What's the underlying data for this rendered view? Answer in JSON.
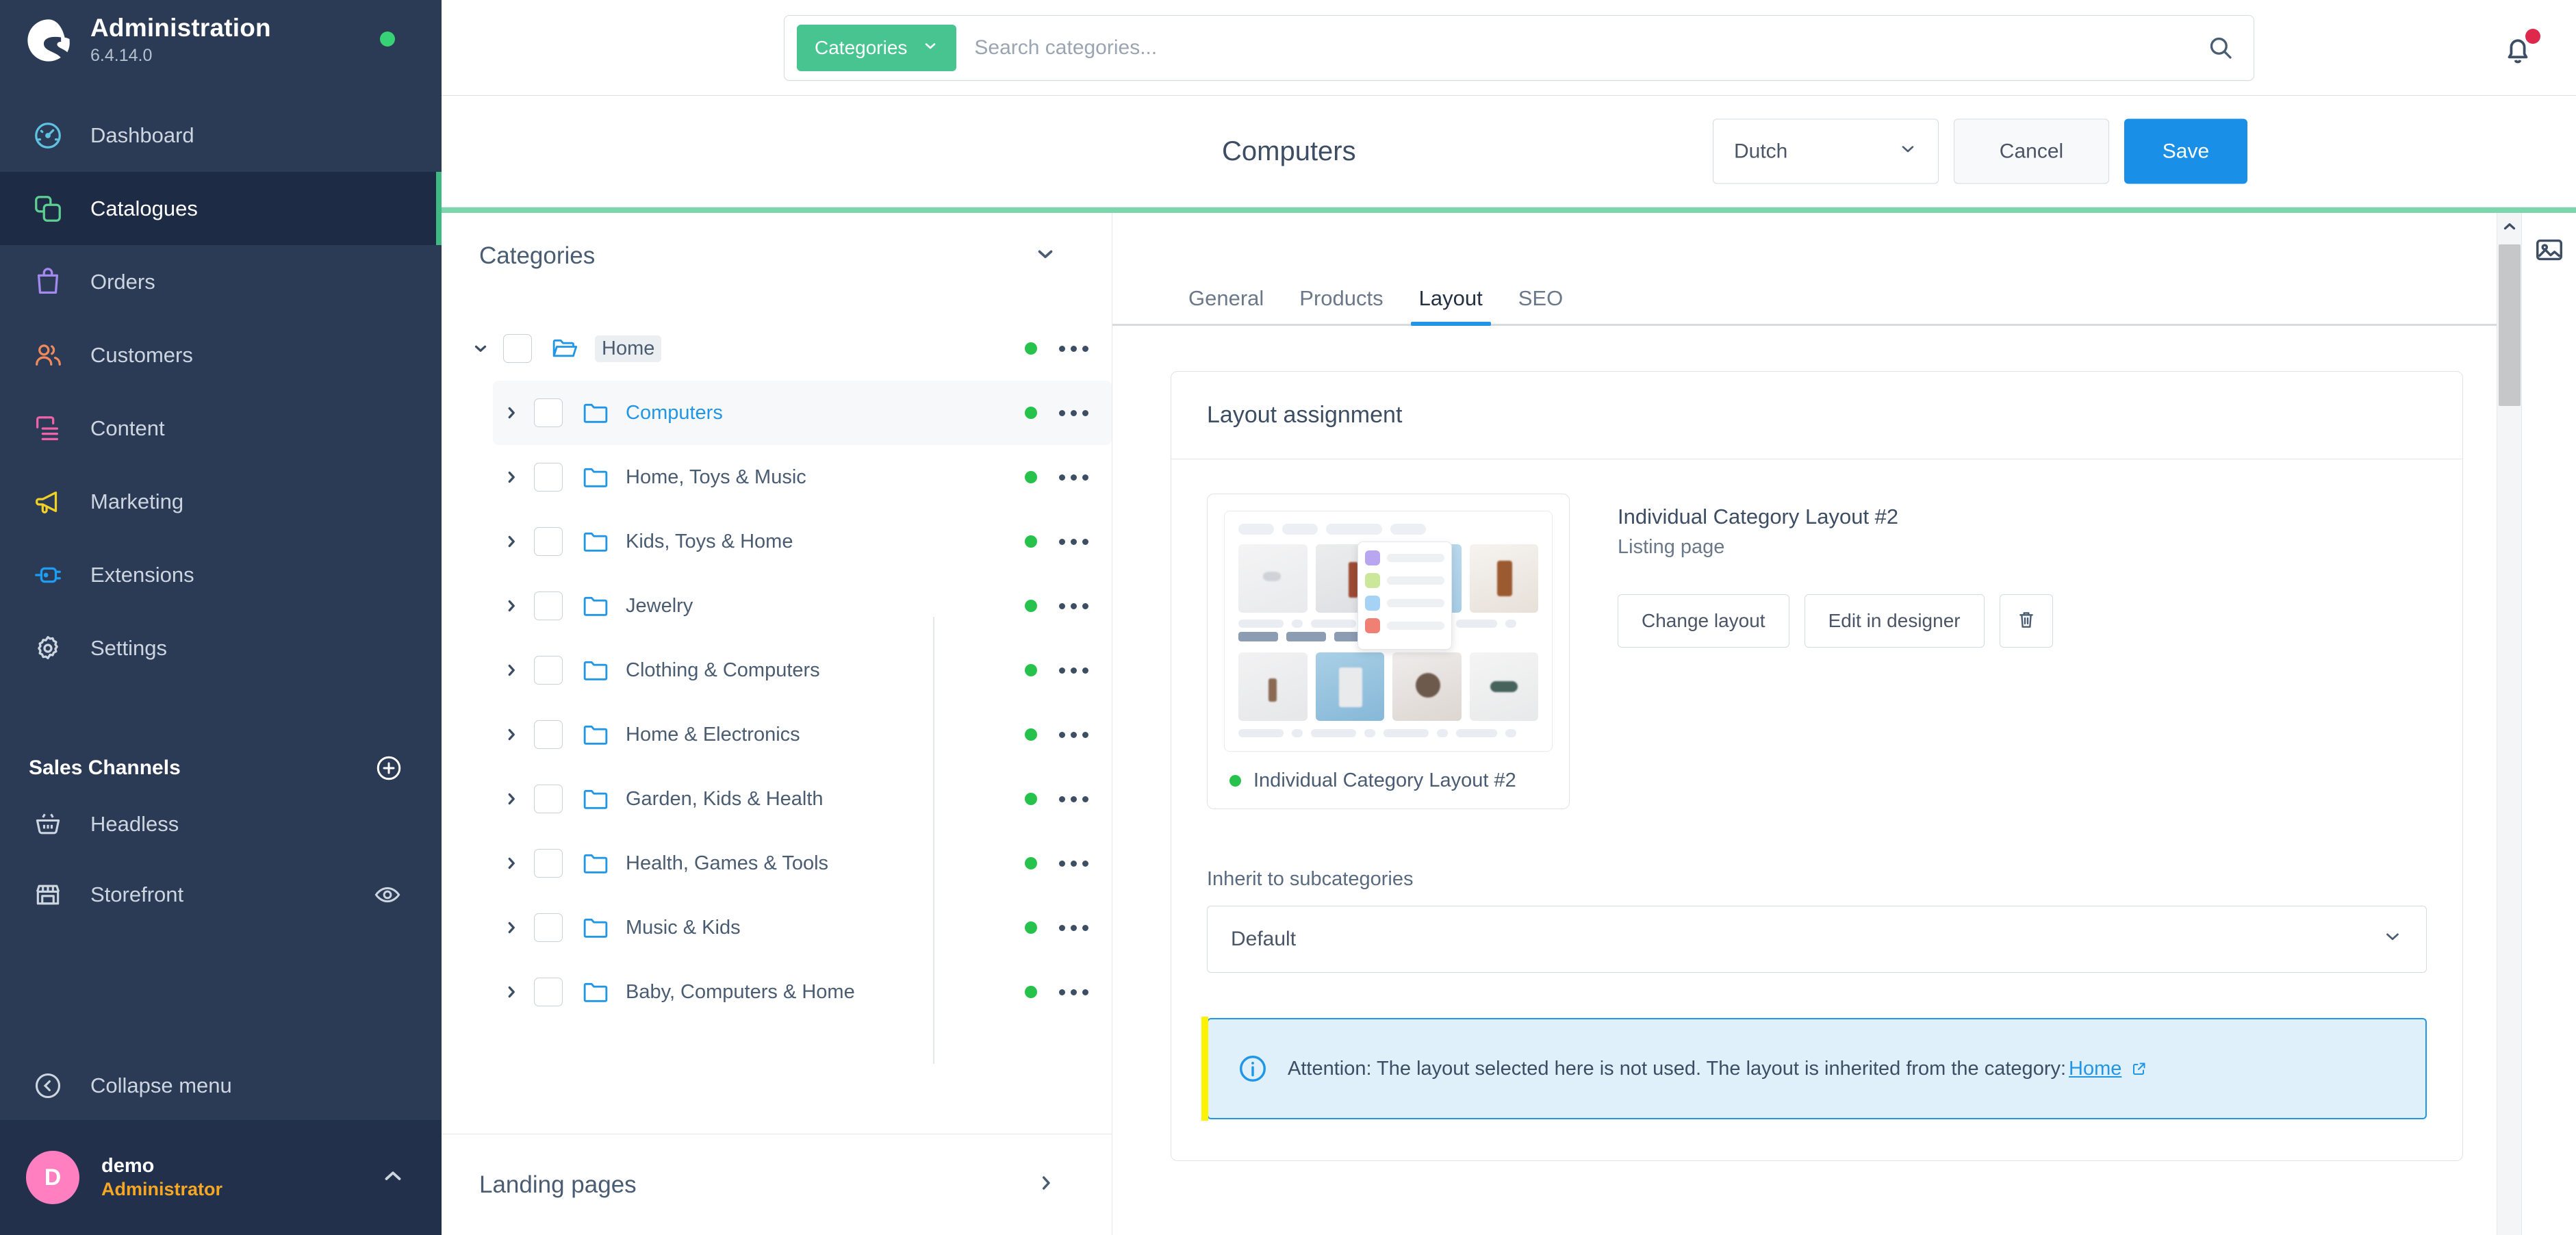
{
  "brand": {
    "logo_icon": "shopware-logo-icon",
    "title": "Administration",
    "version": "6.4.14.0",
    "status_dot_color": "#37d275"
  },
  "sidebar": {
    "nav_items": [
      {
        "label": "Dashboard",
        "icon": "dashboard-icon",
        "color": "#5ec2e0",
        "active": false
      },
      {
        "label": "Catalogues",
        "icon": "catalogues-icon",
        "color": "#5ecf92",
        "active": true
      },
      {
        "label": "Orders",
        "icon": "orders-icon",
        "color": "#a48af0",
        "active": false
      },
      {
        "label": "Customers",
        "icon": "customers-icon",
        "color": "#f08a5d",
        "active": false
      },
      {
        "label": "Content",
        "icon": "content-icon",
        "color": "#f063a8",
        "active": false
      },
      {
        "label": "Marketing",
        "icon": "marketing-icon",
        "color": "#f2d024",
        "active": false
      },
      {
        "label": "Extensions",
        "icon": "extensions-icon",
        "color": "#1e9df5",
        "active": false
      },
      {
        "label": "Settings",
        "icon": "settings-icon",
        "color": "#cdd5e0",
        "active": false
      }
    ],
    "sales_channels": {
      "title": "Sales Channels",
      "add_icon": "plus-circle-icon",
      "items": [
        {
          "label": "Headless",
          "icon": "basket-icon",
          "trailing_icon": ""
        },
        {
          "label": "Storefront",
          "icon": "storefront-icon",
          "trailing_icon": "eye-icon"
        }
      ]
    },
    "collapse": {
      "label": "Collapse menu",
      "icon": "chevron-left-circle-icon"
    },
    "user": {
      "avatar_initial": "D",
      "avatar_color": "#ff7fc0",
      "name": "demo",
      "role": "Administrator",
      "caret_icon": "chevron-up-icon"
    }
  },
  "topbar": {
    "search": {
      "scope_label": "Categories",
      "scope_caret_icon": "chevron-down-icon",
      "scope_color": "#47c490",
      "placeholder": "Search categories...",
      "value": "",
      "submit_icon": "search-icon"
    },
    "notifications": {
      "icon": "bell-icon",
      "badge_color": "#de294c",
      "has_unread": true
    }
  },
  "pagehead": {
    "title": "Computers",
    "language": {
      "value": "Dutch",
      "caret_icon": "chevron-down-icon"
    },
    "cancel_label": "Cancel",
    "save_label": "Save",
    "save_color": "#1a8fe8",
    "accent_rule_color": "#7bd6ab"
  },
  "tree": {
    "header": {
      "title": "Categories",
      "caret_icon": "chevron-down-icon"
    },
    "rows": [
      {
        "label": "Home",
        "level": 0,
        "expanded": true,
        "caret_icon": "chevron-down-icon",
        "folder_icon": "folder-open-icon",
        "selected": false,
        "link": false,
        "highlight": true,
        "status_color": "#27c24c",
        "menu_icon": "ellipsis-icon"
      },
      {
        "label": "Computers",
        "level": 1,
        "expanded": false,
        "caret_icon": "chevron-right-icon",
        "folder_icon": "folder-closed-icon",
        "selected": true,
        "link": true,
        "highlight": false,
        "status_color": "#27c24c",
        "menu_icon": "ellipsis-icon"
      },
      {
        "label": "Home, Toys & Music",
        "level": 1,
        "expanded": false,
        "caret_icon": "chevron-right-icon",
        "folder_icon": "folder-closed-icon",
        "selected": false,
        "link": false,
        "highlight": false,
        "status_color": "#27c24c",
        "menu_icon": "ellipsis-icon"
      },
      {
        "label": "Kids, Toys & Home",
        "level": 1,
        "expanded": false,
        "caret_icon": "chevron-right-icon",
        "folder_icon": "folder-closed-icon",
        "selected": false,
        "link": false,
        "highlight": false,
        "status_color": "#27c24c",
        "menu_icon": "ellipsis-icon"
      },
      {
        "label": "Jewelry",
        "level": 1,
        "expanded": false,
        "caret_icon": "chevron-right-icon",
        "folder_icon": "folder-closed-icon",
        "selected": false,
        "link": false,
        "highlight": false,
        "status_color": "#27c24c",
        "menu_icon": "ellipsis-icon"
      },
      {
        "label": "Clothing & Computers",
        "level": 1,
        "expanded": false,
        "caret_icon": "chevron-right-icon",
        "folder_icon": "folder-closed-icon",
        "selected": false,
        "link": false,
        "highlight": false,
        "status_color": "#27c24c",
        "menu_icon": "ellipsis-icon"
      },
      {
        "label": "Home & Electronics",
        "level": 1,
        "expanded": false,
        "caret_icon": "chevron-right-icon",
        "folder_icon": "folder-closed-icon",
        "selected": false,
        "link": false,
        "highlight": false,
        "status_color": "#27c24c",
        "menu_icon": "ellipsis-icon"
      },
      {
        "label": "Garden, Kids & Health",
        "level": 1,
        "expanded": false,
        "caret_icon": "chevron-right-icon",
        "folder_icon": "folder-closed-icon",
        "selected": false,
        "link": false,
        "highlight": false,
        "status_color": "#27c24c",
        "menu_icon": "ellipsis-icon"
      },
      {
        "label": "Health, Games & Tools",
        "level": 1,
        "expanded": false,
        "caret_icon": "chevron-right-icon",
        "folder_icon": "folder-closed-icon",
        "selected": false,
        "link": false,
        "highlight": false,
        "status_color": "#27c24c",
        "menu_icon": "ellipsis-icon"
      },
      {
        "label": "Music & Kids",
        "level": 1,
        "expanded": false,
        "caret_icon": "chevron-right-icon",
        "folder_icon": "folder-closed-icon",
        "selected": false,
        "link": false,
        "highlight": false,
        "status_color": "#27c24c",
        "menu_icon": "ellipsis-icon"
      },
      {
        "label": "Baby, Computers & Home",
        "level": 1,
        "expanded": false,
        "caret_icon": "chevron-right-icon",
        "folder_icon": "folder-closed-icon",
        "selected": false,
        "link": false,
        "highlight": false,
        "status_color": "#27c24c",
        "menu_icon": "ellipsis-icon"
      }
    ],
    "footer": {
      "label": "Landing pages",
      "caret_icon": "chevron-right-icon"
    }
  },
  "tabs": [
    {
      "label": "General",
      "active": false
    },
    {
      "label": "Products",
      "active": false
    },
    {
      "label": "Layout",
      "active": true
    },
    {
      "label": "SEO",
      "active": false
    }
  ],
  "layout_card": {
    "title": "Layout assignment",
    "preview_caption": "Individual Category Layout #2",
    "preview_status_color": "#27c24c",
    "name": "Individual Category Layout #2",
    "type": "Listing page",
    "buttons": {
      "change_label": "Change layout",
      "edit_label": "Edit in designer",
      "delete_icon": "trash-icon"
    },
    "inherit": {
      "label": "Inherit to subcategories",
      "value": "Default",
      "caret_icon": "chevron-down-icon"
    },
    "notice": {
      "icon": "info-circle-icon",
      "text": "Attention: The layout selected here is not used. The layout is inherited from the category:",
      "link_label": "Home",
      "link_icon": "external-link-icon",
      "border_color": "#2296e6",
      "background_color": "#dff0fb",
      "highlight_color": "#fff200"
    }
  },
  "scrollbar": {
    "up_icon": "chevron-up-icon"
  },
  "right_rail": {
    "icon": "media-image-icon"
  }
}
